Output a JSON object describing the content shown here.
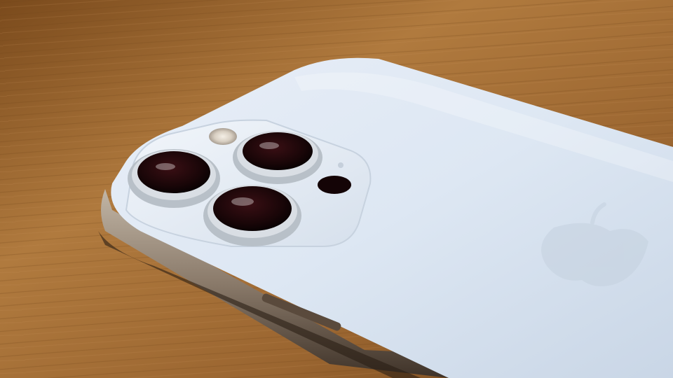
{
  "scene": {
    "subject": "phone-back-with-triple-camera",
    "colors": {
      "table_light": "#b07a3e",
      "table_dark": "#6e4218",
      "phone_back": "#dfe8f4",
      "phone_back_shadow": "#b9c6d6",
      "frame_steel": "#8a7a6a",
      "lens_black": "#1a0608",
      "module_glass": "#e6edf5"
    },
    "icons": [
      "camera-lens-icon",
      "flash-icon",
      "lidar-sensor-icon",
      "microphone-hole-icon",
      "apple-logo-icon"
    ]
  }
}
